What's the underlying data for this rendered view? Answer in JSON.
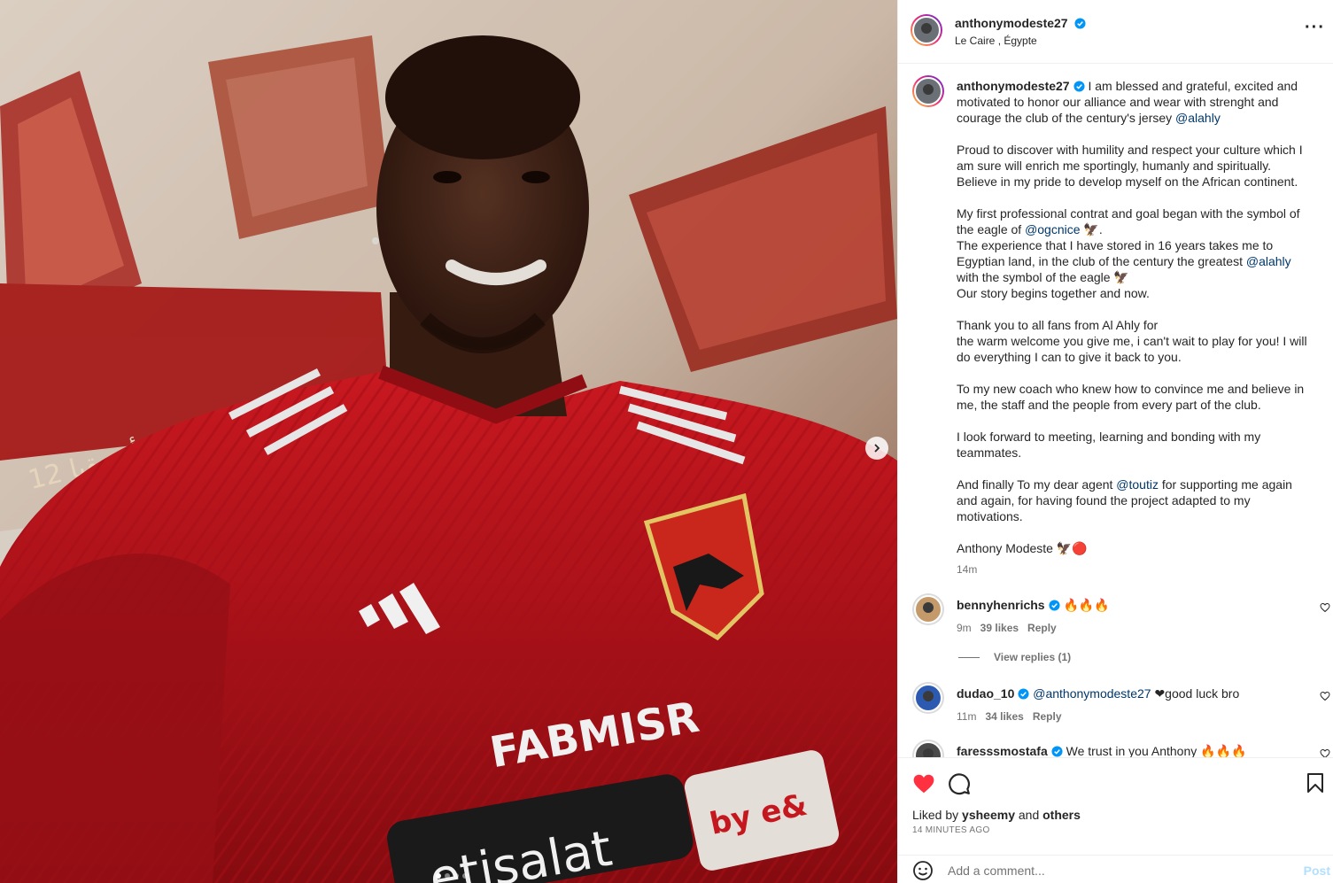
{
  "post": {
    "username": "anthonymodeste27",
    "location": "Le Caire , Égypte"
  },
  "media": {
    "jersey_brand": "FABMISR",
    "jersey_sponsor": "etisalat",
    "jersey_sponsor_badge": "by e&",
    "banner_text": "الأهلي بطل أفريقيا 12",
    "carousel_count": 4,
    "carousel_active": 0
  },
  "caption": {
    "username": "anthonymodeste27",
    "p1_text": "I am blessed and grateful, excited and motivated to honor our alliance and wear with strenght and courage the club of the century's jersey ",
    "p1_mention": "@alahly",
    "p2": "Proud to discover with humility and respect your culture which I am sure will enrich me sportingly, humanly and spiritually. Believe in my pride to develop myself on the African continent.",
    "p3_a": "My first professional contrat and goal began with the symbol of the eagle of ",
    "p3_mention1": "@ogcnice",
    "p3_b": " 🦅.",
    "p3_c": "The experience that I have stored in 16 years takes me to Egyptian land, in the club of the century the greatest ",
    "p3_mention2": "@alahly",
    "p3_d": "with the symbol of the eagle 🦅",
    "p3_e": "Our story begins together and now.",
    "p4_a": "Thank you to all fans from Al Ahly for",
    "p4_b": "the warm welcome you give me, i can't wait to play for you! I will do everything I can to give it back to you.",
    "p5": "To my new coach who knew how to convince me and believe in me, the staff and the people from every part of the club.",
    "p6": "I look forward to meeting, learning and bonding with my teammates.",
    "p7_a": "And finally To my dear agent ",
    "p7_mention": "@toutiz",
    "p7_b": " for supporting me again and again, for having found the project adapted to my motivations.",
    "signature": "Anthony Modeste 🦅🔴",
    "time": "14m"
  },
  "comments": [
    {
      "username": "bennyhenrichs",
      "text": "🔥🔥🔥",
      "time": "9m",
      "likes": "39 likes",
      "reply": "Reply",
      "view_replies": "View replies (1)"
    },
    {
      "username": "dudao_10",
      "mention": "@anthonymodeste27",
      "text": " ❤good luck bro",
      "time": "11m",
      "likes": "34 likes",
      "reply": "Reply"
    },
    {
      "username": "faresssmostafa",
      "text": "We trust in you Anthony 🔥🔥🔥"
    }
  ],
  "actions": {
    "liked_prefix": "Liked by ",
    "liked_user": "ysheemy",
    "liked_and": " and ",
    "liked_others": "others",
    "time_ago": "14 MINUTES AGO"
  },
  "add_comment": {
    "placeholder": "Add a comment...",
    "post_label": "Post"
  },
  "colors": {
    "like_red": "#ff3040",
    "verified_blue": "#0095f6",
    "mention_blue": "#00376b",
    "jersey_red": "#c8141e"
  }
}
